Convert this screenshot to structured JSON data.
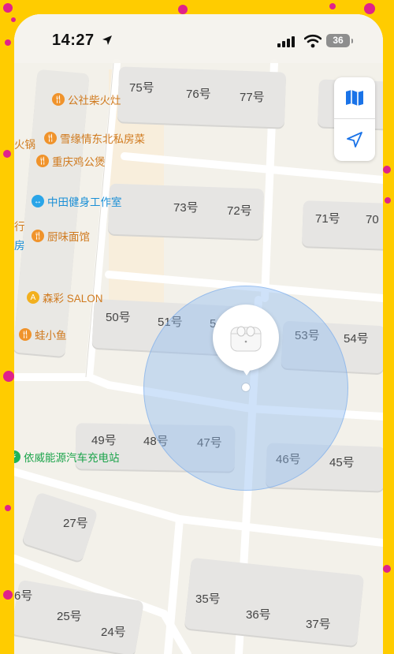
{
  "status_bar": {
    "time": "14:27",
    "battery": "36"
  },
  "map_controls": {
    "map_icon": "map-icon",
    "location_icon": "location-arrow-icon"
  },
  "buildings": {
    "b75": "75号",
    "b76": "76号",
    "b77": "77号",
    "b73": "73号",
    "b72": "72号",
    "b71": "71号",
    "b70": "70",
    "b50": "50号",
    "b51": "51号",
    "b52": "5",
    "b53": "53号",
    "b54": "54号",
    "b49": "49号",
    "b48": "48号",
    "b47": "47号",
    "b46": "46号",
    "b45": "45号",
    "b27": "27号",
    "b35": "35号",
    "b36": "36号",
    "b37": "37号",
    "b26": "6号",
    "b25": "25号",
    "b24": "24号"
  },
  "pois": {
    "p1": "公社柴火灶",
    "p2": "雪缘情东北私房菜",
    "p3": "重庆鸡公煲",
    "p4": "中田健身工作室",
    "p5": "厨味面馆",
    "p6": "森彩 SALON",
    "p7": "蛙小鱼",
    "p8": "依威能源汽车充电站"
  },
  "edge_labels": {
    "e1": "火锅",
    "e2": "行",
    "e3": "房"
  },
  "device": {
    "name": "AirPods Pro",
    "icon": "airpods-case-icon"
  }
}
